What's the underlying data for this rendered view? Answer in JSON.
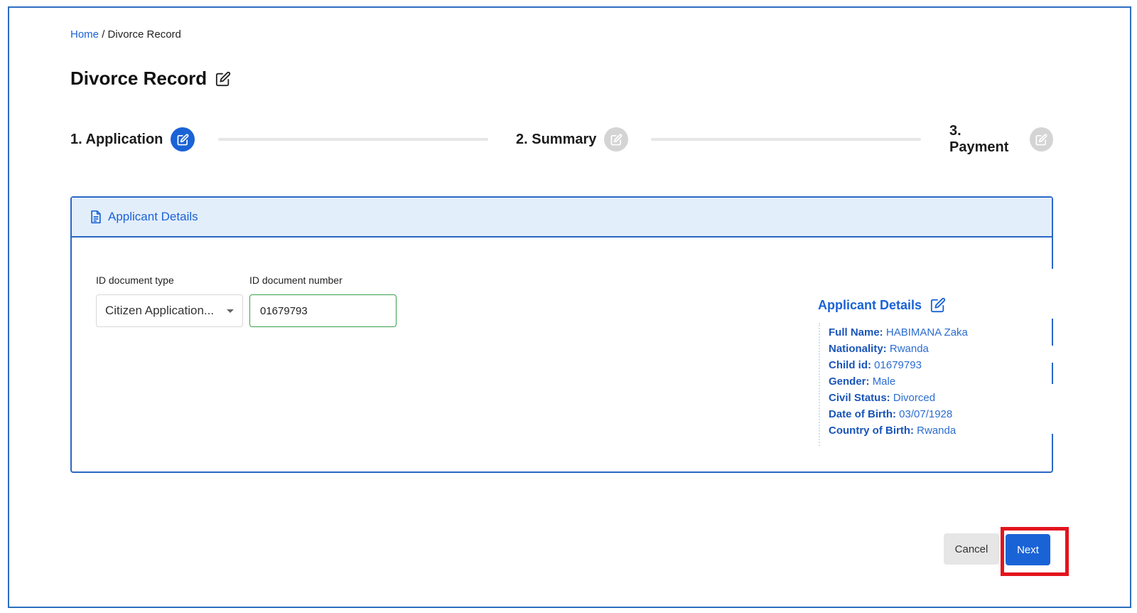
{
  "breadcrumb": {
    "home": "Home",
    "separator": "/",
    "current": "Divorce Record"
  },
  "page": {
    "title": "Divorce Record"
  },
  "stepper": {
    "steps": [
      {
        "label": "1. Application",
        "state": "active"
      },
      {
        "label": "2. Summary",
        "state": "inactive"
      },
      {
        "label": "3. Payment",
        "state": "inactive"
      }
    ]
  },
  "card": {
    "header": "Applicant Details",
    "id_type": {
      "label": "ID document type",
      "value": "Citizen Application..."
    },
    "id_number": {
      "label": "ID document number",
      "value": "01679793"
    },
    "details": {
      "title": "Applicant Details",
      "rows": [
        {
          "key": "Full Name:",
          "value": "HABIMANA Zaka"
        },
        {
          "key": "Nationality:",
          "value": "Rwanda"
        },
        {
          "key": "Child id:",
          "value": "01679793"
        },
        {
          "key": "Gender:",
          "value": "Male"
        },
        {
          "key": "Civil Status:",
          "value": "Divorced"
        },
        {
          "key": "Date of Birth:",
          "value": "03/07/1928"
        },
        {
          "key": "Country of Birth:",
          "value": "Rwanda"
        }
      ]
    }
  },
  "actions": {
    "cancel": "Cancel",
    "next": "Next"
  },
  "colors": {
    "primary": "#1a63d6",
    "highlight": "#e3131d",
    "valid": "#3aa14c"
  }
}
